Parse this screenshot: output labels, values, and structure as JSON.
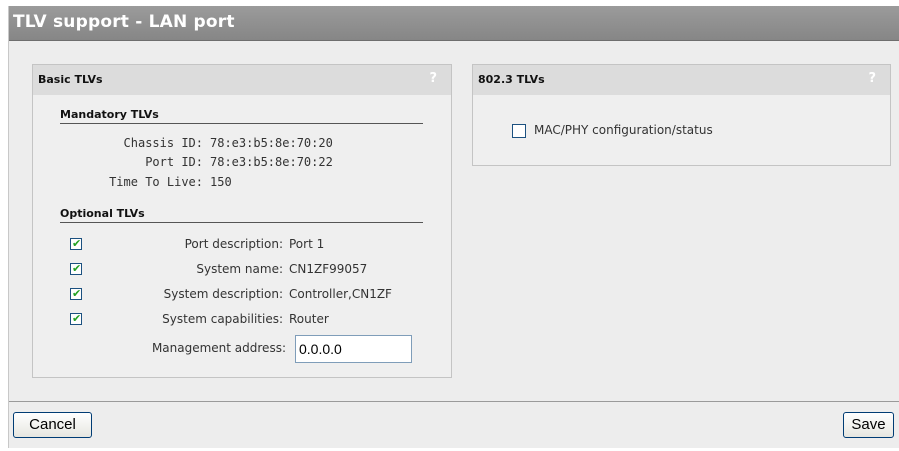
{
  "title": "TLV support - LAN port",
  "basic_panel": {
    "title": "Basic TLVs",
    "help": "?",
    "mandatory_title": "Mandatory TLVs",
    "mandatory": [
      {
        "label": "Chassis ID:",
        "value": "78:e3:b5:8e:70:20"
      },
      {
        "label": "Port ID:",
        "value": "78:e3:b5:8e:70:22"
      },
      {
        "label": "Time To Live:",
        "value": "150"
      }
    ],
    "optional_title": "Optional TLVs",
    "optional": [
      {
        "label": "Port description:",
        "value": "Port 1",
        "checked": true
      },
      {
        "label": "System name:",
        "value": "CN1ZF99057",
        "checked": true
      },
      {
        "label": "System description:",
        "value": "Controller,CN1ZF",
        "checked": true
      },
      {
        "label": "System capabilities:",
        "value": "Router",
        "checked": true
      }
    ],
    "mgmt_label": "Management address:",
    "mgmt_value": "0.0.0.0"
  },
  "dot3_panel": {
    "title": "802.3 TLVs",
    "help": "?",
    "mac_phy_label": "MAC/PHY configuration/status",
    "mac_phy_checked": false
  },
  "buttons": {
    "cancel": "Cancel",
    "save": "Save"
  },
  "check_glyph": "✔"
}
